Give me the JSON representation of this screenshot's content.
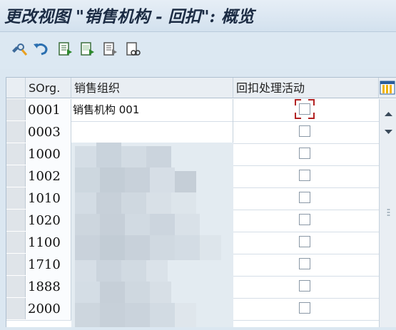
{
  "window": {
    "title": "更改视图 \"销售机构 - 回扣\": 概览"
  },
  "toolbar": {
    "buttons": [
      {
        "icon": "display-change-icon"
      },
      {
        "icon": "undo-icon"
      },
      {
        "icon": "new-entries-icon"
      },
      {
        "icon": "copy-icon"
      },
      {
        "icon": "delete-icon"
      },
      {
        "icon": "select-all-icon"
      }
    ]
  },
  "table": {
    "columns": {
      "sorg": "SOrg.",
      "name": "销售组织",
      "rebate": "回扣处理活动"
    },
    "rows": [
      {
        "sorg": "0001",
        "name": "销售机构 001",
        "rebate": false,
        "focused": true
      },
      {
        "sorg": "0003",
        "name": "",
        "rebate": false
      },
      {
        "sorg": "1000",
        "name": "",
        "rebate": false
      },
      {
        "sorg": "1002",
        "name": "",
        "rebate": false
      },
      {
        "sorg": "1010",
        "name": "",
        "rebate": false
      },
      {
        "sorg": "1020",
        "name": "",
        "rebate": false
      },
      {
        "sorg": "1100",
        "name": "",
        "rebate": false
      },
      {
        "sorg": "1710",
        "name": "",
        "rebate": false
      },
      {
        "sorg": "1888",
        "name": "",
        "rebate": false
      },
      {
        "sorg": "2000",
        "name": "",
        "rebate": false
      }
    ]
  },
  "colors": {
    "focus": "#b22222",
    "header_bg": "#e9eef3",
    "selector_bg": "#dfe4e9"
  }
}
